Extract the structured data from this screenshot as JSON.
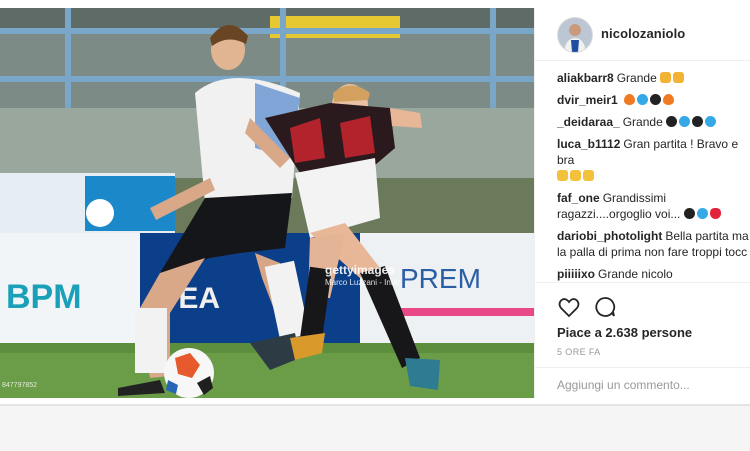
{
  "post": {
    "author": "nicolozaniolo",
    "watermark": "gettyimages",
    "photo_credit": "Marco Luzzani - Inter",
    "image_id": "847797852"
  },
  "comments": [
    {
      "user": "aliakbarr8",
      "text": "Grande",
      "emojis": [
        "clap",
        "clap"
      ]
    },
    {
      "user": "dvir_meir1",
      "text": "",
      "emojis": [
        "fire",
        "blue",
        "black",
        "fire"
      ]
    },
    {
      "user": "_deidaraa_",
      "text": "Grande",
      "emojis": [
        "black",
        "blue",
        "black",
        "blue"
      ]
    },
    {
      "user": "luca_b1112",
      "text": "Gran partita ! Bravo e bra",
      "emojis": [
        "muscle",
        "muscle",
        "muscle"
      ]
    },
    {
      "user": "faf_one",
      "text": "Grandissimi ragazzi....orgoglio voi...",
      "emojis": [
        "black",
        "blue",
        "heart"
      ]
    },
    {
      "user": "dariobi_photolight",
      "text": "Bella partita ma la palla di prima non fare troppi tocc",
      "emojis": []
    },
    {
      "user": "piiiiixo",
      "text": "Grande nicolo",
      "emojis": []
    }
  ],
  "actions": {
    "likes_text": "Piace a 2.638 persone",
    "time_text": "5 ORE FA",
    "comment_placeholder": "Aggiungi un commento..."
  },
  "colors": {
    "text": "#262626",
    "muted": "#999999",
    "border": "#efefef"
  }
}
